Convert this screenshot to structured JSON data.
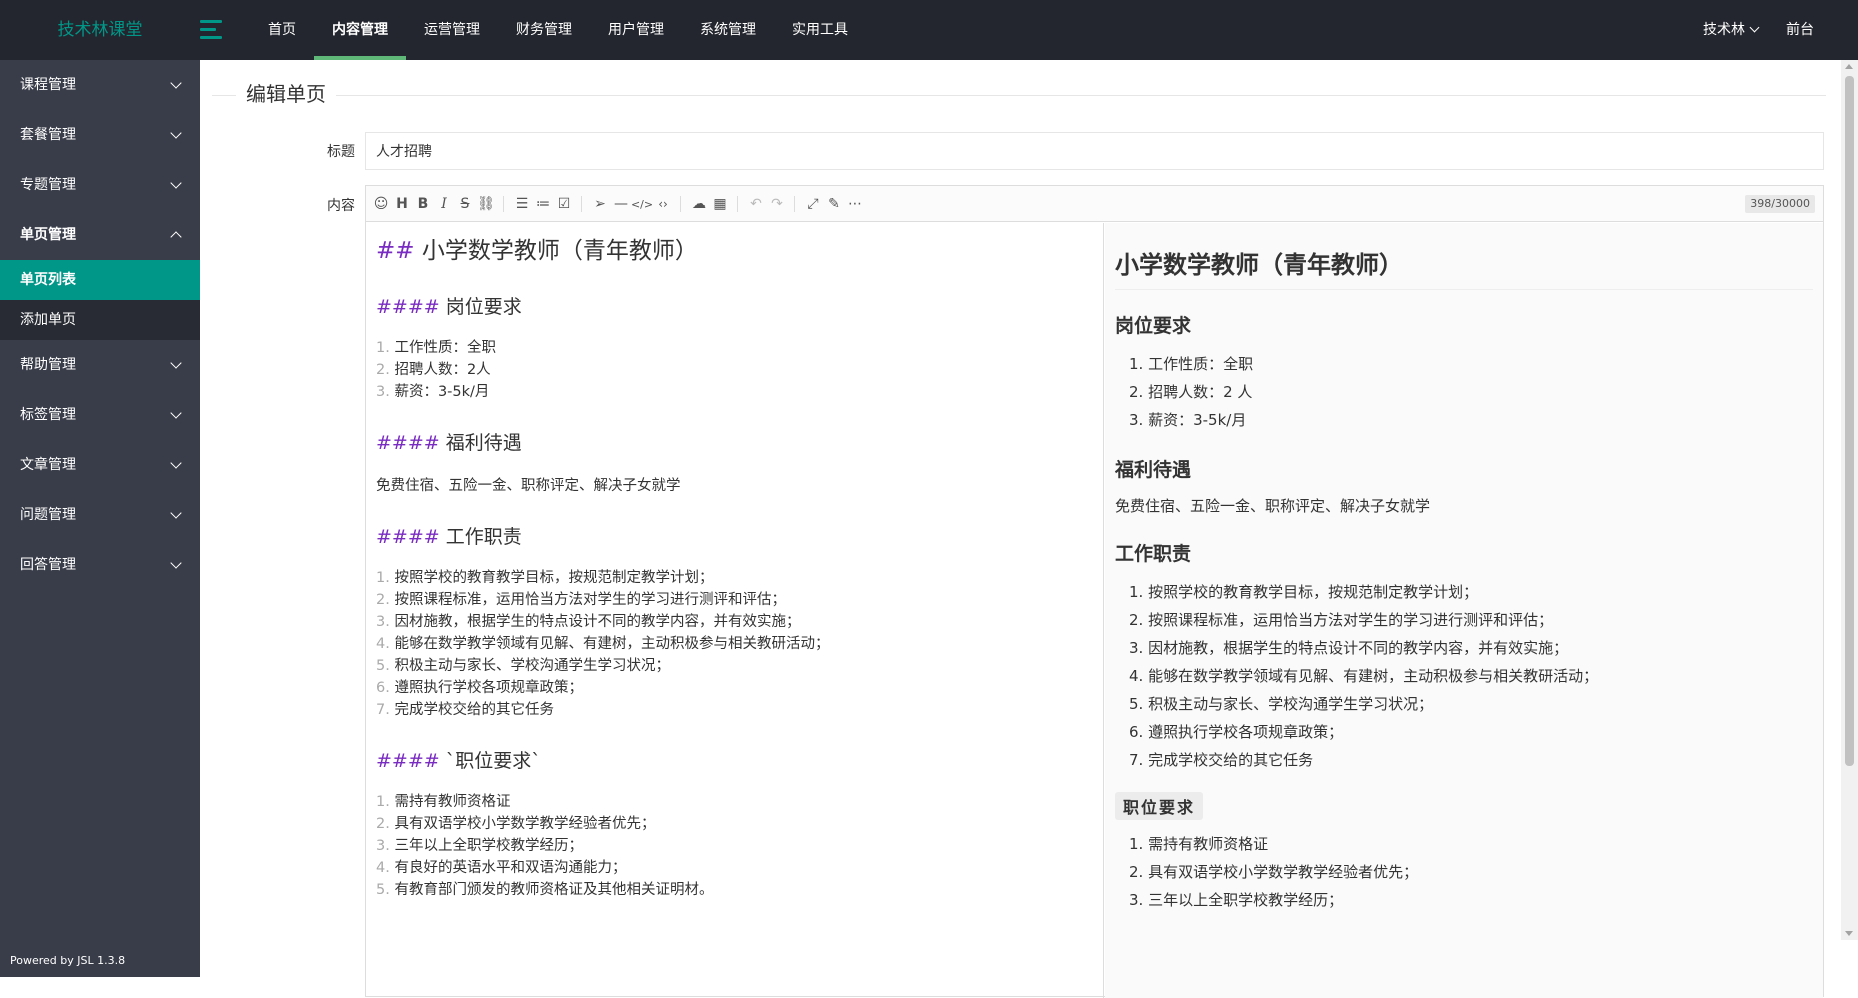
{
  "header": {
    "brand": "技术林课堂",
    "nav": [
      {
        "label": "首页"
      },
      {
        "label": "内容管理",
        "active": true
      },
      {
        "label": "运营管理"
      },
      {
        "label": "财务管理"
      },
      {
        "label": "用户管理"
      },
      {
        "label": "系统管理"
      },
      {
        "label": "实用工具"
      }
    ],
    "user": "技术林",
    "frontend": "前台"
  },
  "sidebar": {
    "items": [
      {
        "label": "课程管理"
      },
      {
        "label": "套餐管理"
      },
      {
        "label": "专题管理"
      },
      {
        "label": "单页管理",
        "open": true,
        "children": [
          {
            "label": "单页列表",
            "active": true
          },
          {
            "label": "添加单页"
          }
        ]
      },
      {
        "label": "帮助管理"
      },
      {
        "label": "标签管理"
      },
      {
        "label": "文章管理"
      },
      {
        "label": "问题管理"
      },
      {
        "label": "回答管理"
      }
    ],
    "powered": "Powered by JSL 1.3.8"
  },
  "form": {
    "legend": "编辑单页",
    "title_label": "标题",
    "title_value": "人才招聘",
    "content_label": "内容",
    "counter": "398/30000"
  },
  "toolbar_icons": [
    "emoji-icon",
    "heading-icon",
    "bold-icon",
    "italic-icon",
    "strike-icon",
    "link-icon",
    "unordered-list-icon",
    "ordered-list-icon",
    "checklist-icon",
    "quote-icon",
    "hr-icon",
    "code-icon",
    "inline-code-icon",
    "upload-icon",
    "table-icon",
    "undo-icon",
    "redo-icon",
    "fullscreen-icon",
    "edit-icon",
    "more-icon"
  ],
  "source": {
    "h2": "小学数学教师（青年教师）",
    "s1_title": "岗位要求",
    "s1_items": [
      "工作性质：全职",
      "招聘人数：2人",
      "薪资：3-5k/月"
    ],
    "s2_title": "福利待遇",
    "s2_text": "免费住宿、五险一金、职称评定、解决子女就学",
    "s3_title": "工作职责",
    "s3_items": [
      "按照学校的教育教学目标，按规范制定教学计划；",
      "按照课程标准，运用恰当方法对学生的学习进行测评和评估；",
      "因材施教，根据学生的特点设计不同的教学内容，并有效实施；",
      "能够在数学教学领域有见解、有建树，主动积极参与相关教研活动；",
      "积极主动与家长、学校沟通学生学习状况；",
      "遵照执行学校各项规章政策；",
      "完成学校交给的其它任务"
    ],
    "s4_title": "`职位要求`",
    "s4_items": [
      "需持有教师资格证",
      "具有双语学校小学数学教学经验者优先；",
      "三年以上全职学校教学经历；",
      "有良好的英语水平和双语沟通能力；",
      "有教育部门颁发的教师资格证及其他相关证明材。"
    ]
  },
  "preview": {
    "h2": "小学数学教师（青年教师）",
    "s1_title": "岗位要求",
    "s1_items": [
      "工作性质：全职",
      "招聘人数：2 人",
      "薪资：3-5k/月"
    ],
    "s2_title": "福利待遇",
    "s2_text": "免费住宿、五险一金、职称评定、解决子女就学",
    "s3_title": "工作职责",
    "s3_items": [
      "按照学校的教育教学目标，按规范制定教学计划；",
      "按照课程标准，运用恰当方法对学生的学习进行测评和评估；",
      "因材施教，根据学生的特点设计不同的教学内容，并有效实施；",
      "能够在数学教学领域有见解、有建树，主动积极参与相关教研活动；",
      "积极主动与家长、学校沟通学生学习状况；",
      "遵照执行学校各项规章政策；",
      "完成学校交给的其它任务"
    ],
    "s4_code": "职位要求",
    "s4_items": [
      "需持有教师资格证",
      "具有双语学校小学数学教学经验者优先；",
      "三年以上全职学校教学经历；"
    ]
  }
}
